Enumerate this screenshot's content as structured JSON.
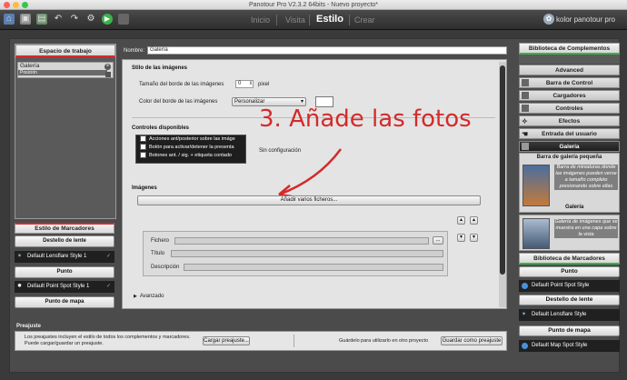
{
  "window": {
    "title": "Panotour Pro V2.3.2 64bits - Nuevo proyecto*"
  },
  "nav": {
    "tabs": [
      "Inicio",
      "Visita",
      "Estilo",
      "Crear"
    ],
    "active": "Estilo"
  },
  "brand": "kolor panotour pro",
  "workspace": {
    "header": "Espacio de trabajo",
    "item_name": "Galería",
    "item_sub": "Posición"
  },
  "markers_style": {
    "header": "Estilo de Marcadores",
    "sections": [
      "Destello de lente",
      "Punto",
      "Punto de mapa"
    ],
    "lensflare_item": "Default Lensflare Style 1",
    "point_item": "Default Point Spot Style 1"
  },
  "editor": {
    "name_label": "Nombre:",
    "name_value": "Galería",
    "images_style": {
      "title": "Stilo de las imágenes",
      "border_size_label": "Tamaño del borde de las imágenes",
      "border_size_value": "0",
      "border_unit": "pixel",
      "border_color_label": "Color del borde de las imágenes",
      "border_color_value": "Personalizar"
    },
    "controls": {
      "title": "Controles disponibles",
      "items": [
        "Acciones ant/posterior sobre las imáge",
        "Botón para activar/detener la presenta",
        "Botones ant. / sig. + etiqueta contado"
      ],
      "config_label": "Sin configuración"
    },
    "images": {
      "title": "Imágenes",
      "add_button": "Añadir varios ficheros...",
      "file_label": "Fichero",
      "browse_label": "...",
      "title_label": "Título",
      "desc_label": "Descripción"
    },
    "advanced": "Avanzado",
    "annotation": "3. Añade las fotos"
  },
  "presets": {
    "title": "Preajuste",
    "description_line1": "Los preajustes incluyen el estilo de todos los complementos y marcadores.",
    "description_line2": "Puede cargar/guardar un preajuste.",
    "load_button": "Cargar preajuste...",
    "save_text": "Guárdelo para utilizarlo en otro proyecto",
    "save_button": "Guardar como preajuste"
  },
  "components": {
    "header": "Biblioteca de Complementos",
    "items": [
      "Advanced",
      "Barra de Control",
      "Cargadores",
      "Controles",
      "Efectos",
      "Entrada del usuario",
      "Galería"
    ],
    "card1_title": "Barra de galería pequeña",
    "card1_desc": "Barra de miniaturas donde las imágenes pueden verse a tamaño completo presionando sobre ellas",
    "card1_name": "Galería",
    "card2_desc": "Galería de imágenes que se muestra en una capa sobre la vista"
  },
  "markers_library": {
    "header": "Biblioteca de Marcadores",
    "sections": [
      "Punto",
      "Destello de lente",
      "Punto de mapa"
    ],
    "items": [
      "Default Point Spot Style",
      "Default Lensflare Style",
      "Default Map Spot Style"
    ]
  },
  "colors": {
    "accent_red": "#d42a2a",
    "dark": "#202020"
  }
}
